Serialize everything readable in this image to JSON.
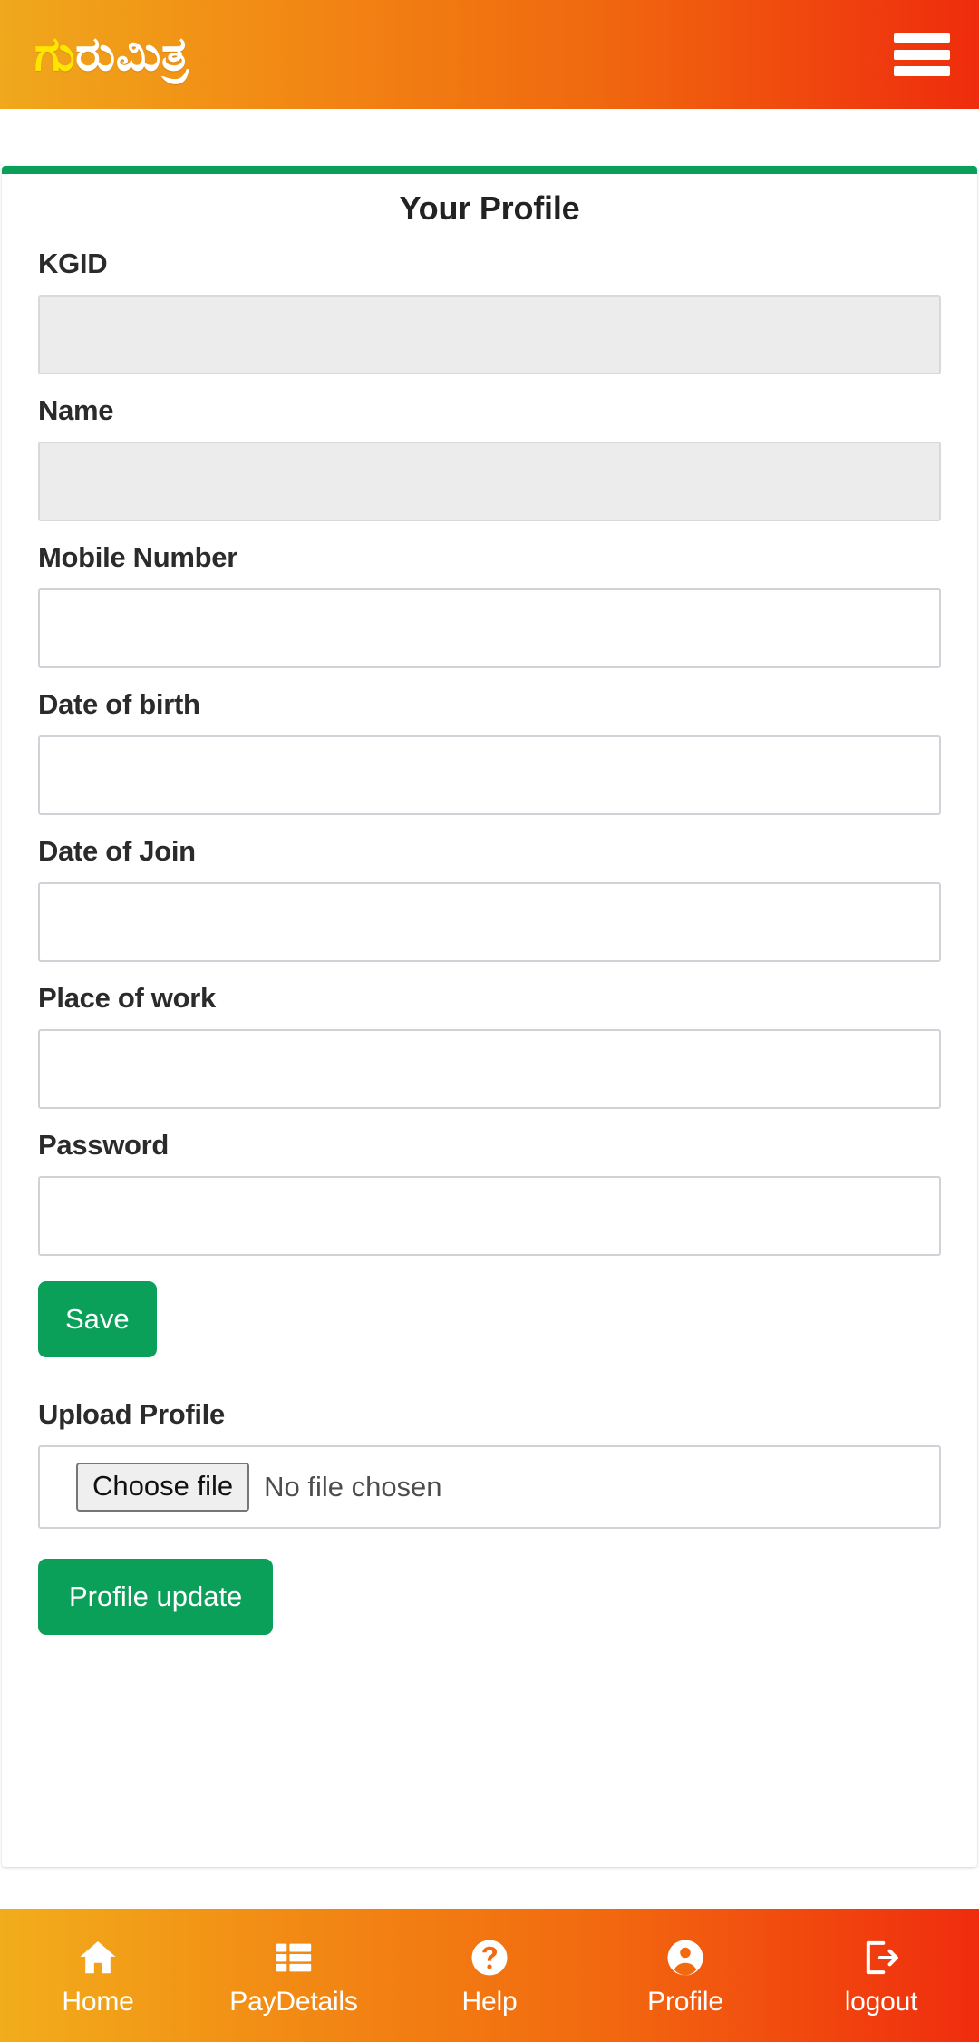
{
  "header": {
    "brand_lead": "ಗು",
    "brand_rest": "ರುಮಿತ್ರ",
    "brand_full": "ಗುರುಮಿತ್ರ",
    "menu_icon": "hamburger-menu-icon",
    "gradient_from": "#f0a81c",
    "gradient_to": "#ef2c0d"
  },
  "card": {
    "title": "Your Profile",
    "accent_color": "#0aa05a",
    "fields": [
      {
        "label": "KGID",
        "value": "",
        "placeholder": "",
        "disabled": true
      },
      {
        "label": "Name",
        "value": "",
        "placeholder": "",
        "disabled": true
      },
      {
        "label": "Mobile Number",
        "value": "",
        "placeholder": "",
        "disabled": false
      },
      {
        "label": "Date of birth",
        "value": "",
        "placeholder": "",
        "disabled": false
      },
      {
        "label": "Date of Join",
        "value": "",
        "placeholder": "",
        "disabled": false
      },
      {
        "label": "Place of work",
        "value": "",
        "placeholder": "",
        "disabled": false
      },
      {
        "label": "Password",
        "value": "",
        "placeholder": "",
        "disabled": false
      }
    ],
    "save_label": "Save",
    "upload_label": "Upload Profile",
    "choose_file_label": "Choose file",
    "file_status": "No file chosen",
    "profile_update_label": "Profile update"
  },
  "tabbar": {
    "items": [
      {
        "label": "Home",
        "icon": "home-icon"
      },
      {
        "label": "PayDetails",
        "icon": "list-icon"
      },
      {
        "label": "Help",
        "icon": "question-circle-icon"
      },
      {
        "label": "Profile",
        "icon": "person-circle-icon"
      },
      {
        "label": "logout",
        "icon": "logout-icon"
      }
    ]
  }
}
